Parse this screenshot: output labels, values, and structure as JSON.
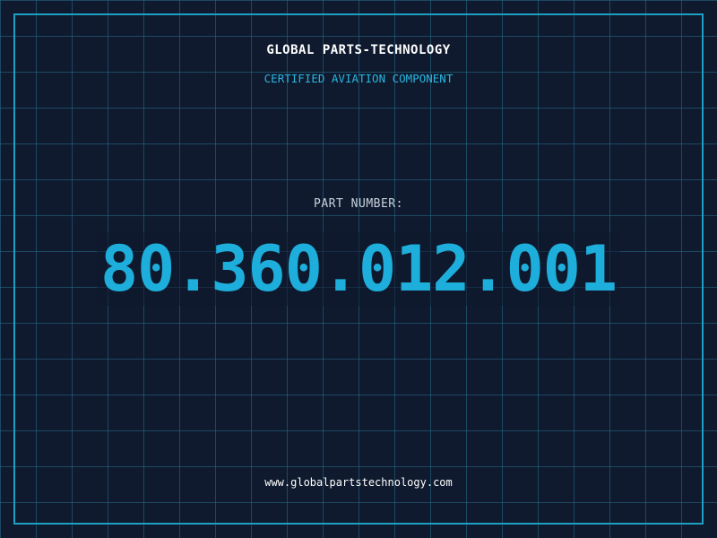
{
  "header": {
    "company_name": "GLOBAL PARTS-TECHNOLOGY",
    "tagline": "CERTIFIED AVIATION COMPONENT"
  },
  "part": {
    "label": "PART NUMBER:",
    "number": "80.360.012.001"
  },
  "footer": {
    "website": "www.globalpartstechnology.com"
  },
  "colors": {
    "background": "#0f1a2e",
    "grid_line": "#286e8c",
    "frame": "#1e9fc4",
    "accent": "#1eaedc",
    "tagline": "#29b5e0",
    "label": "#c9d3de",
    "text": "#ffffff"
  }
}
